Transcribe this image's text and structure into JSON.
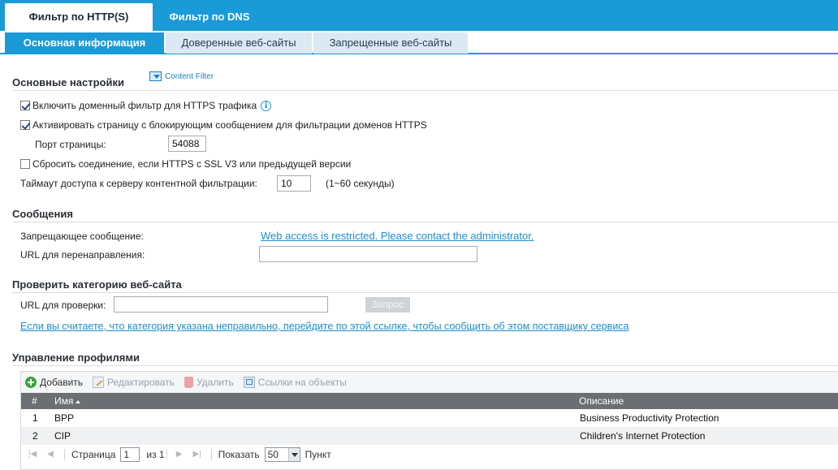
{
  "top_tabs": {
    "http": "Фильтр по HTTP(S)",
    "dns": "Фильтр по DNS"
  },
  "sub_tabs": {
    "basic": "Основная информация",
    "trusted": "Доверенные веб-сайты",
    "forbidden": "Запрещенные веб-сайты"
  },
  "basic_settings": {
    "title": "Основные настройки",
    "content_filter_link": "Content Filter",
    "enable_https_filter": {
      "label": "Включить доменный фильтр для HTTPS трафика",
      "checked": true
    },
    "activate_block_page": {
      "label": "Активировать страницу с блокирующим сообщением для фильтрации доменов HTTPS",
      "checked": true
    },
    "page_port_label": "Порт страницы:",
    "page_port_value": "54088",
    "reset_ssl": {
      "label": "Сбросить соединение, если HTTPS с SSL V3 или предыдущей версии",
      "checked": false
    },
    "timeout_label": "Таймаут доступа к серверу контентной фильтрации:",
    "timeout_value": "10",
    "timeout_hint": "(1~60 секунды)"
  },
  "messages": {
    "title": "Сообщения",
    "deny_label": "Запрещающее сообщение:",
    "deny_value": "Web access is restricted. Please contact the administrator.",
    "redirect_label": "URL для перенаправления:",
    "redirect_value": ""
  },
  "category_check": {
    "title": "Проверить категорию веб-сайта",
    "url_label": "URL для проверки:",
    "url_value": "",
    "query_button": "Запрос",
    "report_link": "Если вы считаете, что категория указана неправильно, перейдите по этой ссылке, чтобы сообщить об этом поставщику сервиса"
  },
  "profiles": {
    "title": "Управление профилями",
    "toolbar": {
      "add": "Добавить",
      "edit": "Редактировать",
      "delete": "Удалить",
      "links": "Ссылки на объекты"
    },
    "columns": {
      "num": "#",
      "name": "Имя",
      "desc": "Описание"
    },
    "rows": [
      {
        "num": "1",
        "name": "BPP",
        "desc": "Business Productivity Protection"
      },
      {
        "num": "2",
        "name": "CIP",
        "desc": "Children's Internet Protection"
      }
    ],
    "pager": {
      "page_label": "Страница",
      "page_value": "1",
      "of_label": "из 1",
      "show_label": "Показать",
      "per_page": "50",
      "items_label": "Пункт"
    }
  }
}
